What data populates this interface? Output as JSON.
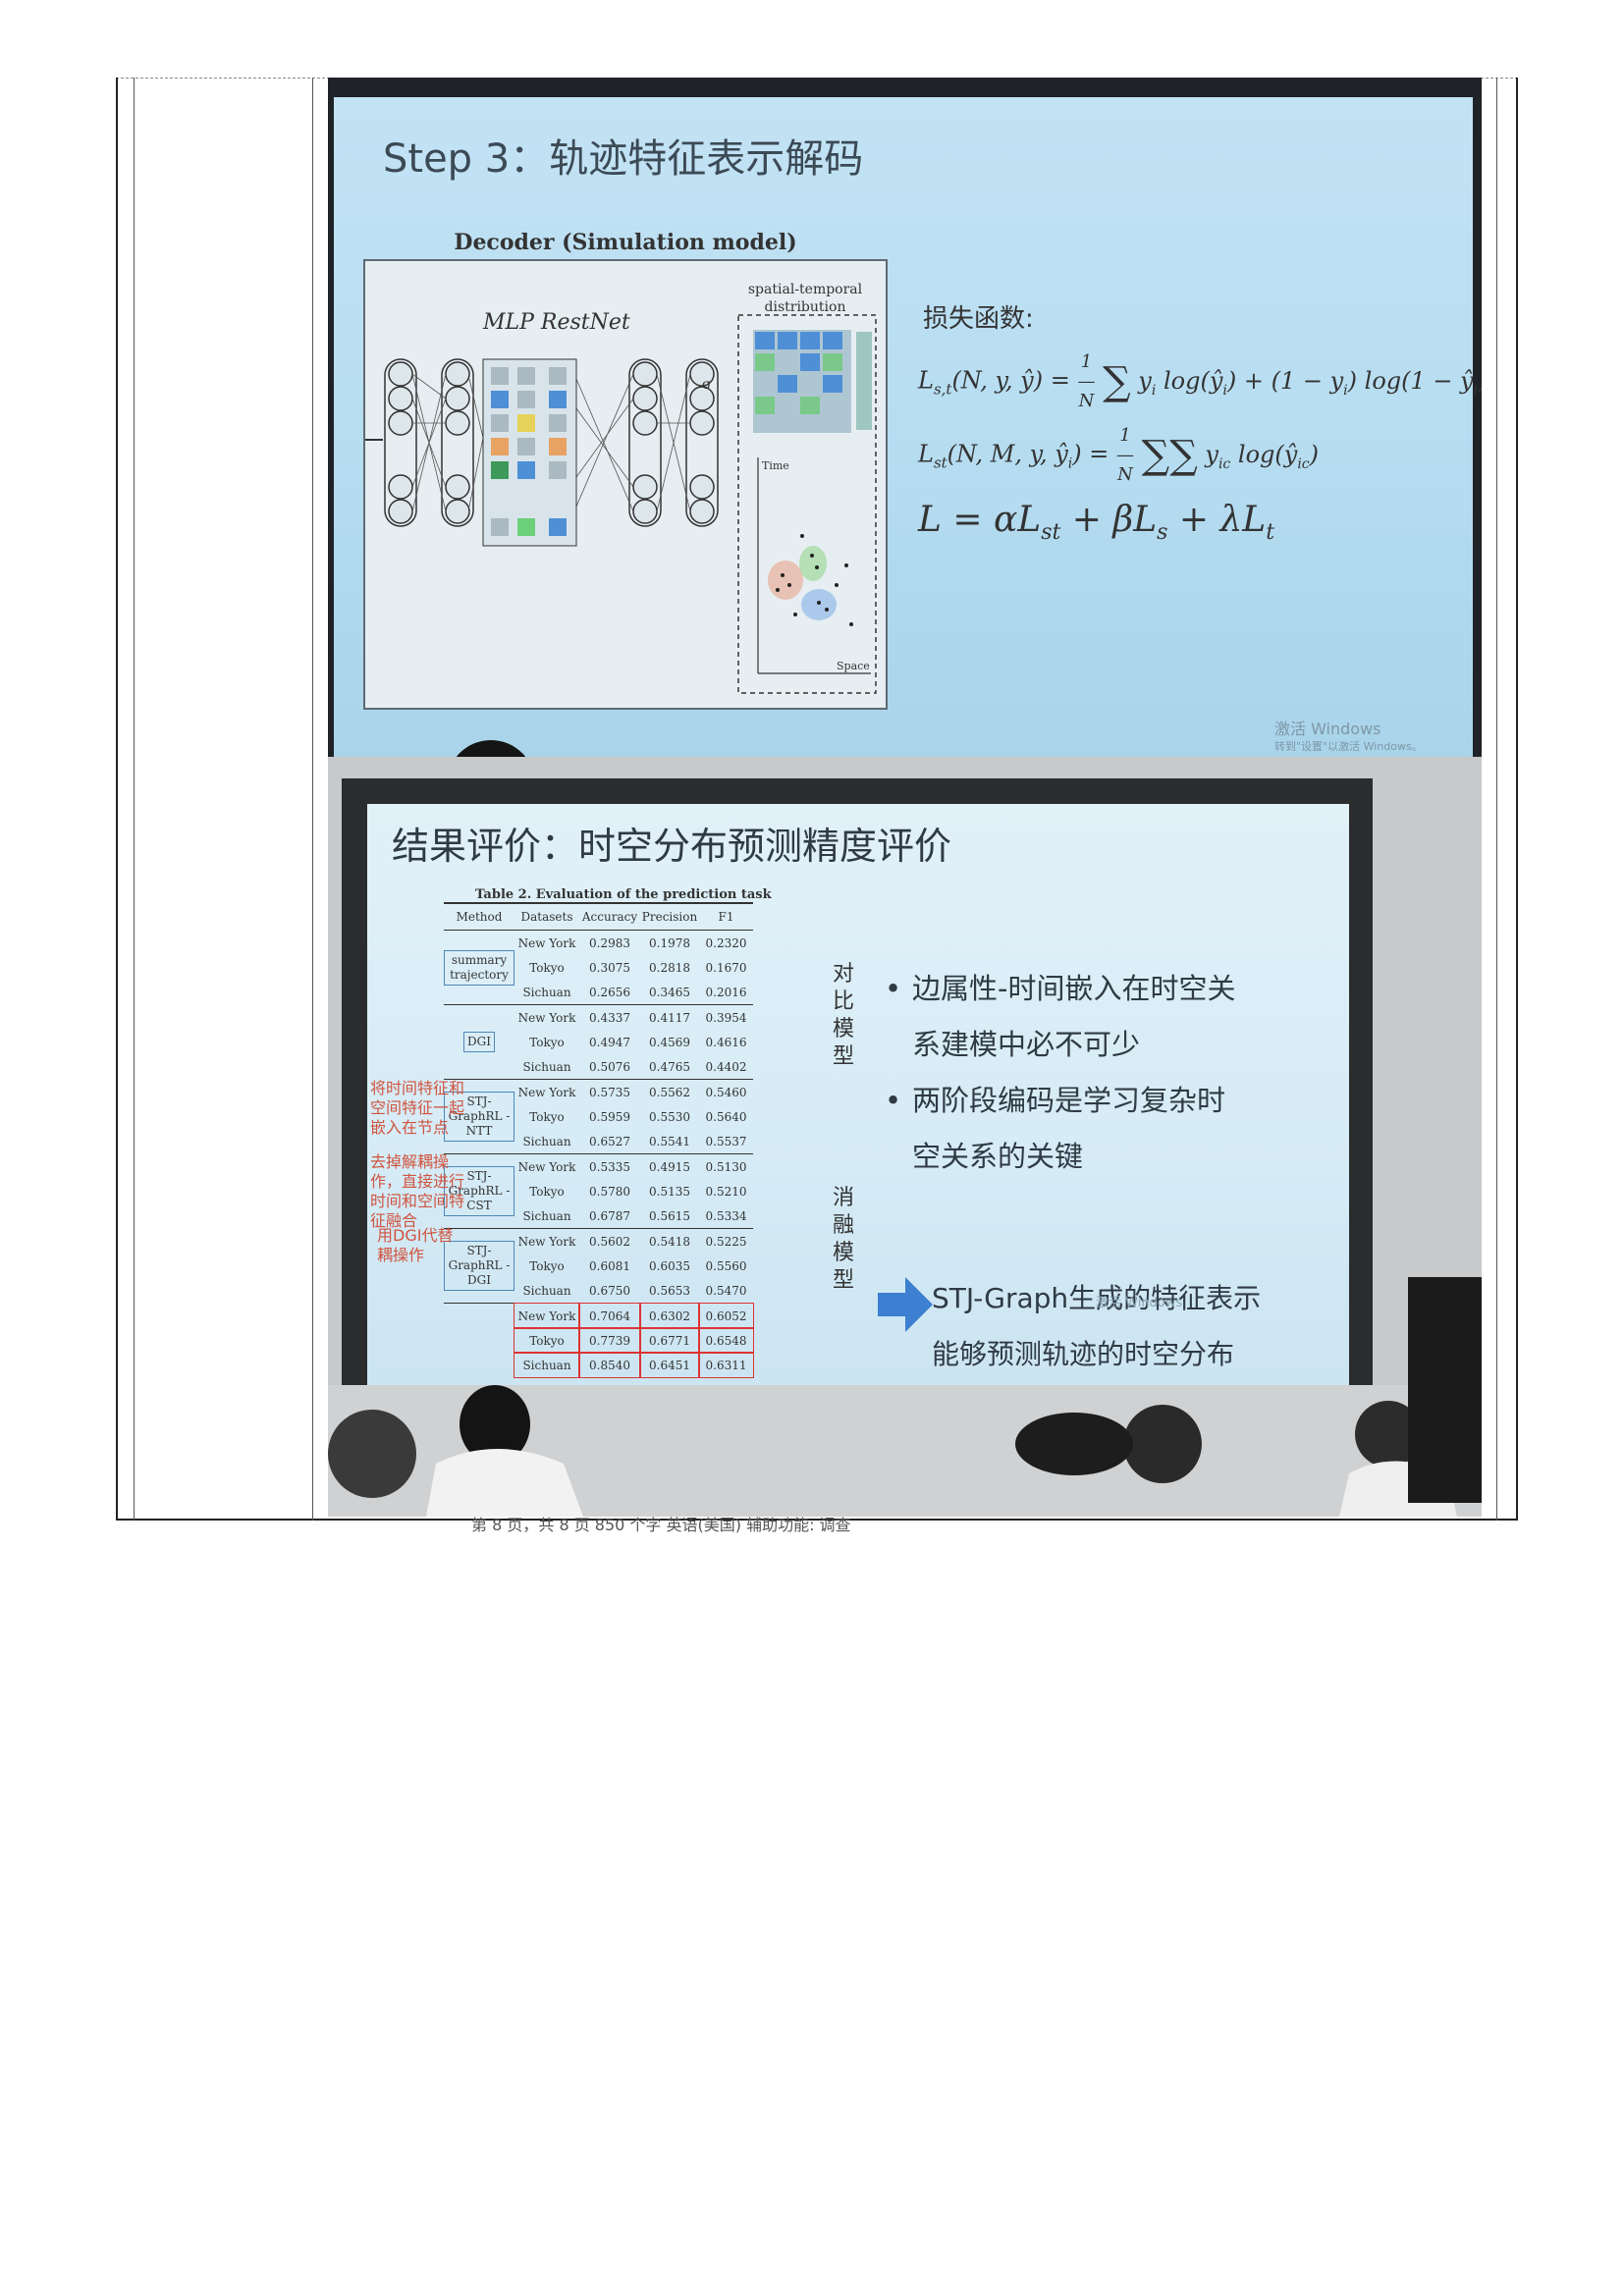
{
  "slide1": {
    "title": "Step 3：轨迹特征表示解码",
    "decoder_title": "Decoder (Simulation model)",
    "mlp_label": "MLP RestNet",
    "distribution_label_1": "spatial-temporal",
    "distribution_label_2": "distribution",
    "axis_time": "Time",
    "axis_space": "Space",
    "sigma": "σ",
    "loss_title": "损失函数:",
    "eq1": "L_{s,t}(N,y,ŷ) = (1/N) Σ_i^N y_i log(ŷ_i) + (1 − y_i) log(1 − ŷ_i)",
    "eq1_lhs": "L",
    "eq1_lhs_sub": "s,t",
    "eq1_args": "(N, y, ŷ) =",
    "eq1_body": "y",
    "eq2_lhs": "L",
    "eq2_lhs_sub": "st",
    "eq2_args": "(N, M, y, ŷ",
    "eq3_text": "L = αL",
    "watermark_line1": "激活 Windows",
    "watermark_line2": "转到\"设置\"以激活 Windows。"
  },
  "slide2": {
    "title": "结果评价：时空分布预测精度评价",
    "table_caption": "Table 2. Evaluation of the prediction task",
    "columns": [
      "Method",
      "Datasets",
      "Accuracy",
      "Precision",
      "F1"
    ],
    "groups": [
      {
        "method": "summary trajectory",
        "rows": [
          [
            "New York",
            "0.2983",
            "0.1978",
            "0.2320"
          ],
          [
            "Tokyo",
            "0.3075",
            "0.2818",
            "0.1670"
          ],
          [
            "Sichuan",
            "0.2656",
            "0.3465",
            "0.2016"
          ]
        ]
      },
      {
        "method": "DGI",
        "rows": [
          [
            "New York",
            "0.4337",
            "0.4117",
            "0.3954"
          ],
          [
            "Tokyo",
            "0.4947",
            "0.4569",
            "0.4616"
          ],
          [
            "Sichuan",
            "0.5076",
            "0.4765",
            "0.4402"
          ]
        ]
      },
      {
        "method": "STJ-GraphRL -NTT",
        "rows": [
          [
            "New York",
            "0.5735",
            "0.5562",
            "0.5460"
          ],
          [
            "Tokyo",
            "0.5959",
            "0.5530",
            "0.5640"
          ],
          [
            "Sichuan",
            "0.6527",
            "0.5541",
            "0.5537"
          ]
        ]
      },
      {
        "method": "STJ-GraphRL -CST",
        "rows": [
          [
            "New York",
            "0.5335",
            "0.4915",
            "0.5130"
          ],
          [
            "Tokyo",
            "0.5780",
            "0.5135",
            "0.5210"
          ],
          [
            "Sichuan",
            "0.6787",
            "0.5615",
            "0.5334"
          ]
        ]
      },
      {
        "method": "STJ-GraphRL -DGI",
        "rows": [
          [
            "New York",
            "0.5602",
            "0.5418",
            "0.5225"
          ],
          [
            "Tokyo",
            "0.6081",
            "0.6035",
            "0.5560"
          ],
          [
            "Sichuan",
            "0.6750",
            "0.5653",
            "0.5470"
          ]
        ]
      },
      {
        "method": "",
        "rows": [
          [
            "New York",
            "0.7064",
            "0.6302",
            "0.6052"
          ],
          [
            "Tokyo",
            "0.7739",
            "0.6771",
            "0.6548"
          ],
          [
            "Sichuan",
            "0.8540",
            "0.6451",
            "0.6311"
          ]
        ]
      }
    ],
    "label_compare": "对比模型",
    "label_ablation": "消融模型",
    "red_note_1": "将时间特征和空间特征一起嵌入在节点",
    "red_note_2": "去掉解耦操作，直接进行时间和空间特征融合",
    "red_note_3": "用DGI代替耦操作",
    "bullet_1_line1": "边属性-时间嵌入在时空关",
    "bullet_1_line2": "系建模中必不可少",
    "bullet_2_line1": "两阶段编码是学习复杂时",
    "bullet_2_line2": "空关系的关键",
    "conclusion_line1": "STJ-Graph生成的特征表示",
    "conclusion_line2": "能够预测轨迹的时空分布",
    "watermark": "激活 Windows",
    "arrow_color": "#3d7fd0"
  },
  "status_bar": "第 8 页，共 8 页    850 个字    英语(美国)    辅助功能: 调查"
}
